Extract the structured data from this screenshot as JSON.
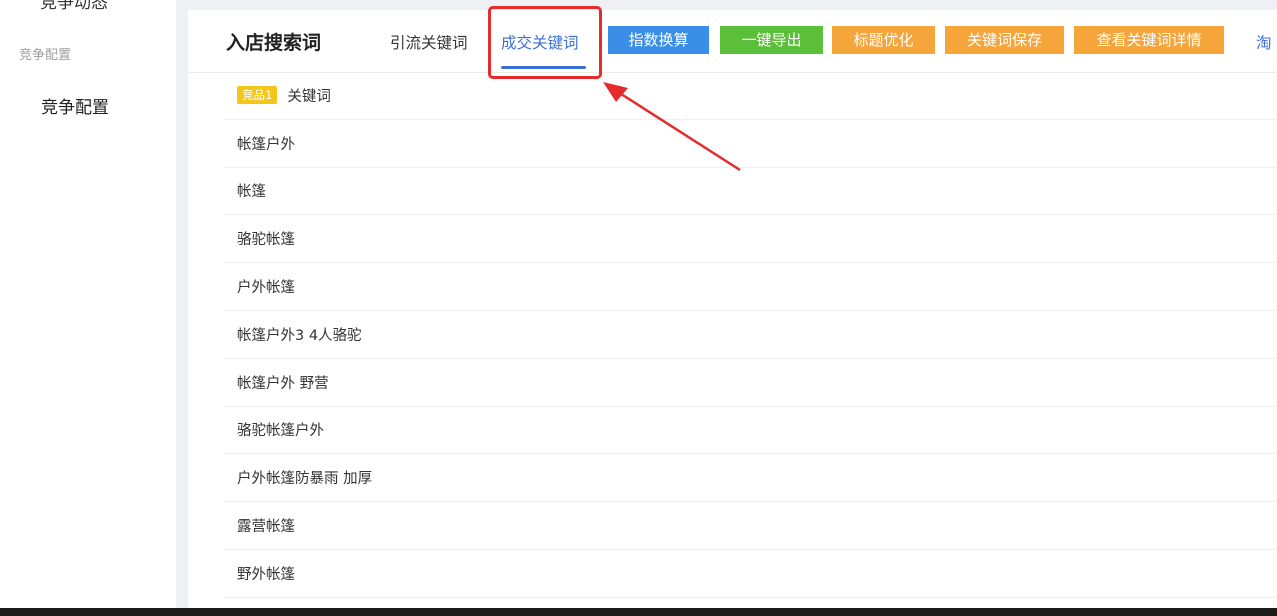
{
  "sidebar": {
    "cut_item": "竞争动态",
    "group_label": "竞争配置",
    "active_item": "竞争配置"
  },
  "header": {
    "title": "入店搜索词",
    "tabs": [
      {
        "label": "引流关键词"
      },
      {
        "label": "成交关键词"
      }
    ],
    "buttons": [
      {
        "label": "指数换算"
      },
      {
        "label": "一键导出"
      },
      {
        "label": "标题优化"
      },
      {
        "label": "关键词保存"
      },
      {
        "label": "查看关键词详情"
      }
    ],
    "cut_link": "淘"
  },
  "list": {
    "badge": "竞品1",
    "header_label": "关键词",
    "items": [
      "帐篷户外",
      "帐篷",
      "骆驼帐篷",
      "户外帐篷",
      "帐篷户外3 4人骆驼",
      "帐篷户外 野营",
      "骆驼帐篷户外",
      "户外帐篷防暴雨 加厚",
      "露营帐篷",
      "野外帐篷"
    ]
  },
  "colors": {
    "accent_blue": "#3b6fd8",
    "button_blue": "#3a8ee8",
    "button_green": "#5cbf3a",
    "button_orange": "#f5a53a",
    "annotation_red": "#e52b2b",
    "badge_yellow": "#f4c51a"
  }
}
